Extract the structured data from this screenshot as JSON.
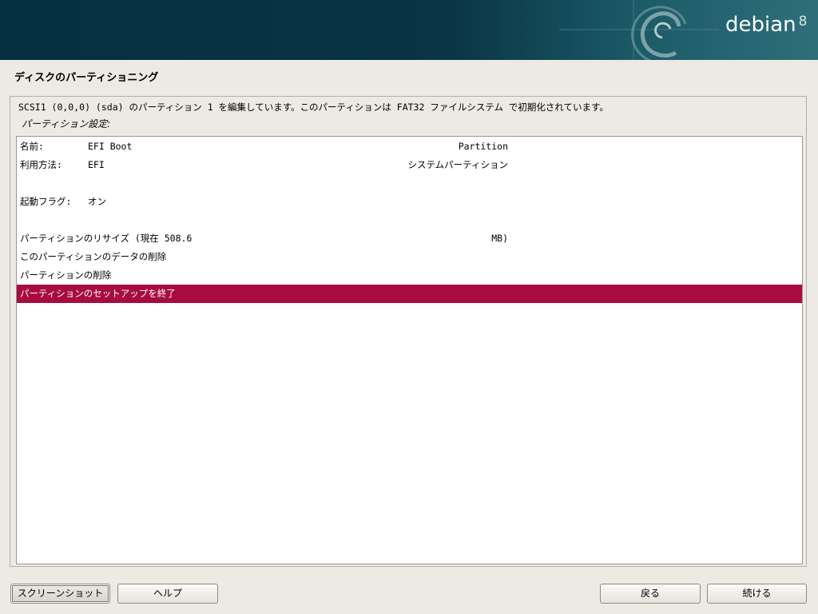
{
  "header": {
    "brand": "debian",
    "version": "8"
  },
  "page_title": "ディスクのパーティショニング",
  "description": "SCSI1 (0,0,0) (sda) のパーティション 1 を編集しています。このパーティションは FAT32 ファイルシステム で初期化されています。",
  "settings_label": "パーティション設定:",
  "rows": [
    {
      "label": "名前:",
      "value": "EFI Boot",
      "right": "Partition",
      "selected": false
    },
    {
      "label": "利用方法:",
      "value": "EFI",
      "right": "システムパーティション",
      "selected": false
    },
    {
      "label": "",
      "value": "",
      "right": "",
      "selected": false
    },
    {
      "label": "起動フラグ:",
      "value": "オン",
      "right": "",
      "selected": false
    },
    {
      "label": "",
      "value": "",
      "right": "",
      "selected": false
    },
    {
      "label": "パーティションのリサイズ (現在 508.6",
      "value": "",
      "right": "MB)",
      "selected": false
    },
    {
      "label": "このパーティションのデータの削除",
      "value": "",
      "right": "",
      "selected": false
    },
    {
      "label": "パーティションの削除",
      "value": "",
      "right": "",
      "selected": false
    },
    {
      "label": "パーティションのセットアップを終了",
      "value": "",
      "right": "",
      "selected": true
    }
  ],
  "buttons": {
    "screenshot": "スクリーンショット",
    "help": "ヘルプ",
    "back": "戻る",
    "continue": "続ける"
  },
  "colors": {
    "header_dark": "#062f40",
    "selection": "#a80b3f",
    "background": "#edeae3"
  }
}
